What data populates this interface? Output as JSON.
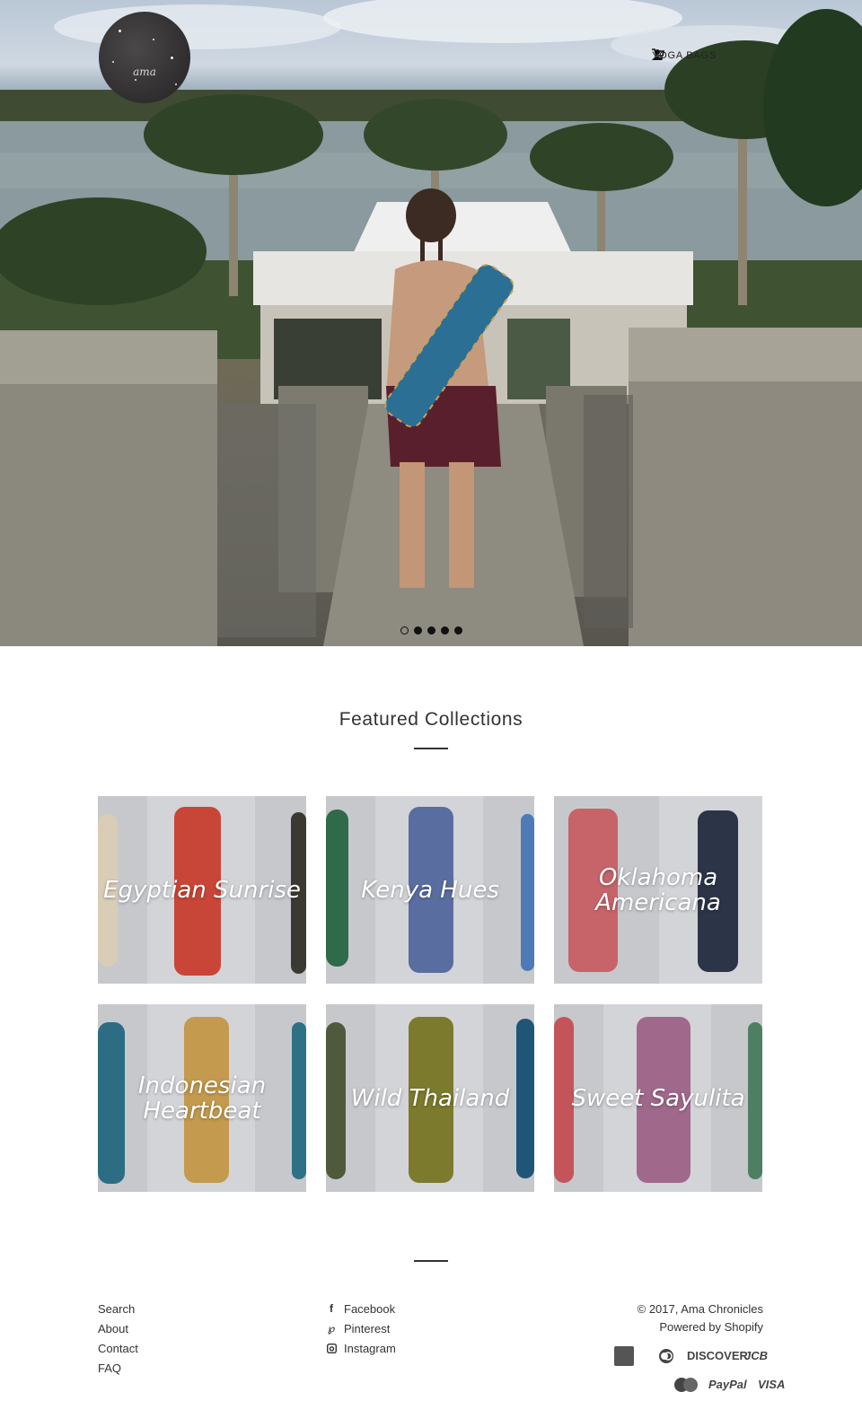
{
  "header": {
    "logo_text": "ama",
    "nav": {
      "yoga_bags": "YOGA BAGS"
    },
    "icons": [
      "user-icon",
      "cart-icon"
    ]
  },
  "slideshow": {
    "slide_count": 5,
    "active_index": 0
  },
  "featured": {
    "title": "Featured Collections",
    "collections": [
      {
        "name": "Egyptian Sunrise"
      },
      {
        "name": "Kenya Hues"
      },
      {
        "name": "Oklahoma Americana"
      },
      {
        "name": "Indonesian Heartbeat"
      },
      {
        "name": "Wild Thailand"
      },
      {
        "name": "Sweet Sayulita"
      }
    ]
  },
  "footer": {
    "links": [
      "Search",
      "About",
      "Contact",
      "FAQ"
    ],
    "social": [
      {
        "label": "Facebook",
        "icon": "facebook-icon"
      },
      {
        "label": "Pinterest",
        "icon": "pinterest-icon"
      },
      {
        "label": "Instagram",
        "icon": "instagram-icon"
      }
    ],
    "copyright": "© 2017, Ama Chronicles",
    "powered": "Powered by Shopify",
    "payments": [
      "american-express-icon",
      "diners-club-icon",
      "DISCOVER",
      "JCB",
      "master-card-icon",
      "PayPal",
      "VISA"
    ]
  }
}
